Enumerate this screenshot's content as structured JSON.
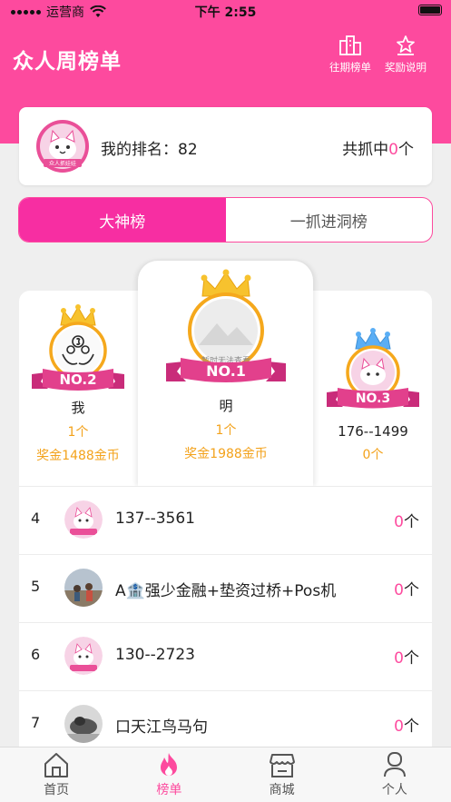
{
  "status": {
    "carrier": "运营商",
    "time": "下午 2:55"
  },
  "header": {
    "title": "众人周榜单",
    "history_label": "往期榜单",
    "reward_label": "奖励说明"
  },
  "my": {
    "rank_label": "我的排名：",
    "rank_value": "82",
    "caught_prefix": "共抓中",
    "caught_value": "0",
    "caught_unit": "个"
  },
  "tabs": [
    {
      "label": "大神榜",
      "active": true
    },
    {
      "label": "一抓进洞榜",
      "active": false
    }
  ],
  "podium": {
    "first": {
      "badge": "NO.1",
      "name": "明",
      "count": "1个",
      "bonus": "奖金1988金币",
      "avatar_text": "暂时无法查看"
    },
    "second": {
      "badge": "NO.2",
      "name": "我",
      "count": "1个",
      "bonus": "奖金1488金币"
    },
    "third": {
      "badge": "NO.3",
      "name": "176--1499",
      "count": "0个"
    }
  },
  "avatar_logo_text": "众人抓娃娃",
  "list": [
    {
      "rank": "4",
      "name": "137--3561",
      "count": "0",
      "unit": "个",
      "avatar": "cat-logo"
    },
    {
      "rank": "5",
      "name": "A🏦强少金融+垫资过桥+Pos机",
      "count": "0",
      "unit": "个",
      "avatar": "photo-people"
    },
    {
      "rank": "6",
      "name": "130--2723",
      "count": "0",
      "unit": "个",
      "avatar": "cat-logo"
    },
    {
      "rank": "7",
      "name": "口天江鸟马句",
      "count": "0",
      "unit": "个",
      "avatar": "photo-gray"
    }
  ],
  "tabbar": [
    {
      "label": "首页",
      "icon": "home-icon",
      "active": false
    },
    {
      "label": "榜单",
      "icon": "flame-icon",
      "active": true
    },
    {
      "label": "商城",
      "icon": "store-icon",
      "active": false
    },
    {
      "label": "个人",
      "icon": "person-icon",
      "active": false
    }
  ],
  "colors": {
    "brand": "#fd4a9e",
    "gold": "#f3a21b",
    "crown_gold": "#f7c22e",
    "crown_blue": "#5aaef5"
  }
}
